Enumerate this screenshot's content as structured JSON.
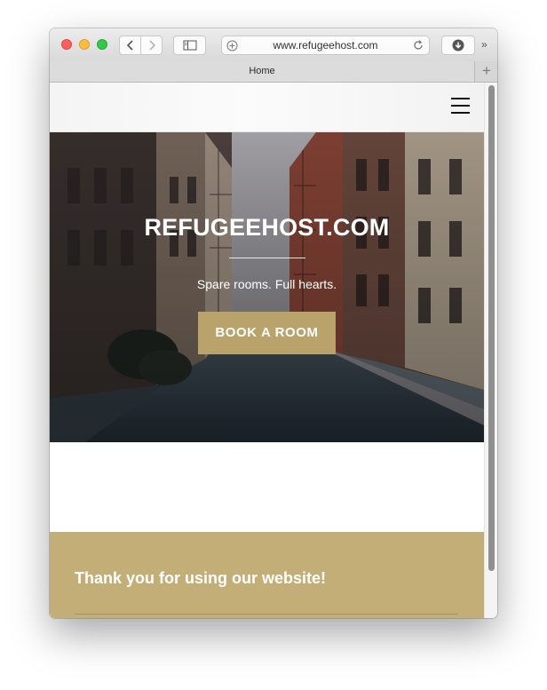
{
  "browser": {
    "url": "www.refugeehost.com",
    "tabs": [
      {
        "label": "Home"
      }
    ],
    "new_tab_label": "+",
    "more_label": "»",
    "icons": [
      "back-icon",
      "forward-icon",
      "sidebar-icon",
      "shield-icon",
      "reload-icon",
      "download-icon",
      "chevrons-icon"
    ]
  },
  "site": {
    "title": "REFUGEEHOST.COM",
    "tagline": "Spare rooms. Full hearts.",
    "cta_label": "BOOK A ROOM",
    "footer_text": "Thank you for using our website!"
  },
  "colors": {
    "accent": "#b9a36b",
    "footer": "#c4ae78",
    "close": "#fc605c",
    "minimize": "#fdbc40",
    "zoom": "#34c84a"
  }
}
